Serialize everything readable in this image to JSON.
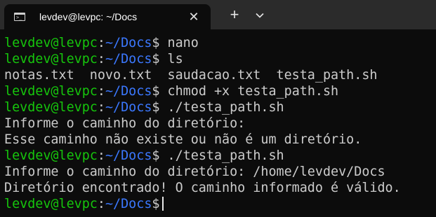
{
  "tab": {
    "title": "levdev@levpc: ~/Docs",
    "icon": "terminal-icon",
    "close_icon": "close-icon"
  },
  "toolbar": {
    "new_tab_icon": "plus-icon",
    "dropdown_icon": "chevron-down-icon"
  },
  "colors": {
    "user": "#16c60c",
    "path": "#3b78ff",
    "text": "#cccccc",
    "background": "#0c0c0c",
    "titlebar": "#2b2b2b"
  },
  "terminal": {
    "prompt_user": "levdev@levpc",
    "prompt_sep": ":",
    "prompt_path": "~/Docs",
    "prompt_symbol": "$",
    "lines": [
      {
        "type": "prompt",
        "command": " nano"
      },
      {
        "type": "prompt",
        "command": " ls"
      },
      {
        "type": "output",
        "text": "notas.txt  novo.txt  saudacao.txt  testa_path.sh"
      },
      {
        "type": "prompt",
        "command": " chmod +x testa_path.sh"
      },
      {
        "type": "prompt",
        "command": " ./testa_path.sh"
      },
      {
        "type": "output",
        "text": "Informe o caminho do diretório:"
      },
      {
        "type": "output",
        "text": "Esse caminho não existe ou não é um diretório."
      },
      {
        "type": "prompt",
        "command": " ./testa_path.sh"
      },
      {
        "type": "output",
        "text": "Informe o caminho do diretório: /home/levdev/Docs"
      },
      {
        "type": "output",
        "text": "Diretório encontrado! O caminho informado é válido."
      },
      {
        "type": "prompt",
        "command": ""
      }
    ]
  }
}
